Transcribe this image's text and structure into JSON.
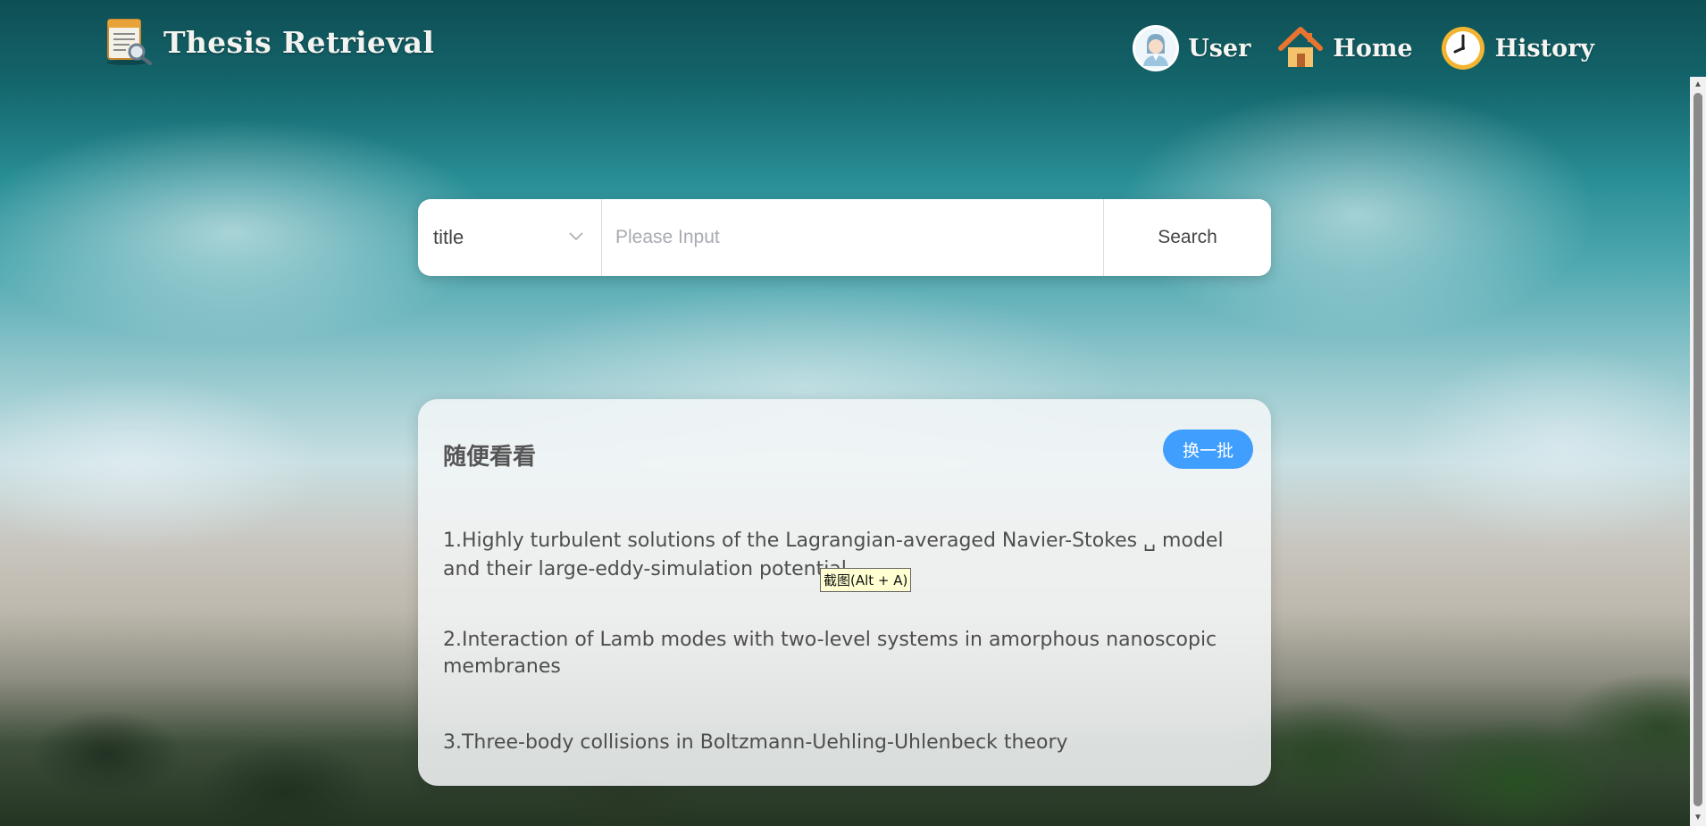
{
  "app": {
    "title": "Thesis Retrieval",
    "logo_icon": "document-search-icon"
  },
  "nav": {
    "items": [
      {
        "label": "User",
        "icon": "user-avatar-icon"
      },
      {
        "label": "Home",
        "icon": "house-icon"
      },
      {
        "label": "History",
        "icon": "clock-icon"
      }
    ]
  },
  "search": {
    "field_selected": "title",
    "placeholder": "Please Input",
    "value": "",
    "button_label": "Search"
  },
  "browse": {
    "title": "随便看看",
    "refresh_label": "换一批",
    "items": [
      "1.Highly turbulent solutions of the Lagrangian-averaged Navier-Stokes ␣ model and their large-eddy-simulation potential",
      "2.Interaction of Lamb modes with two-level systems in amorphous nanoscopic membranes",
      "3.Three-body collisions in Boltzmann-Uehling-Uhlenbeck theory"
    ]
  },
  "tooltip": {
    "text": "截图(Alt + A)"
  },
  "colors": {
    "accent": "#409eff",
    "card_bg": "#f5f7f8",
    "header_text": "#f5f5f2"
  }
}
